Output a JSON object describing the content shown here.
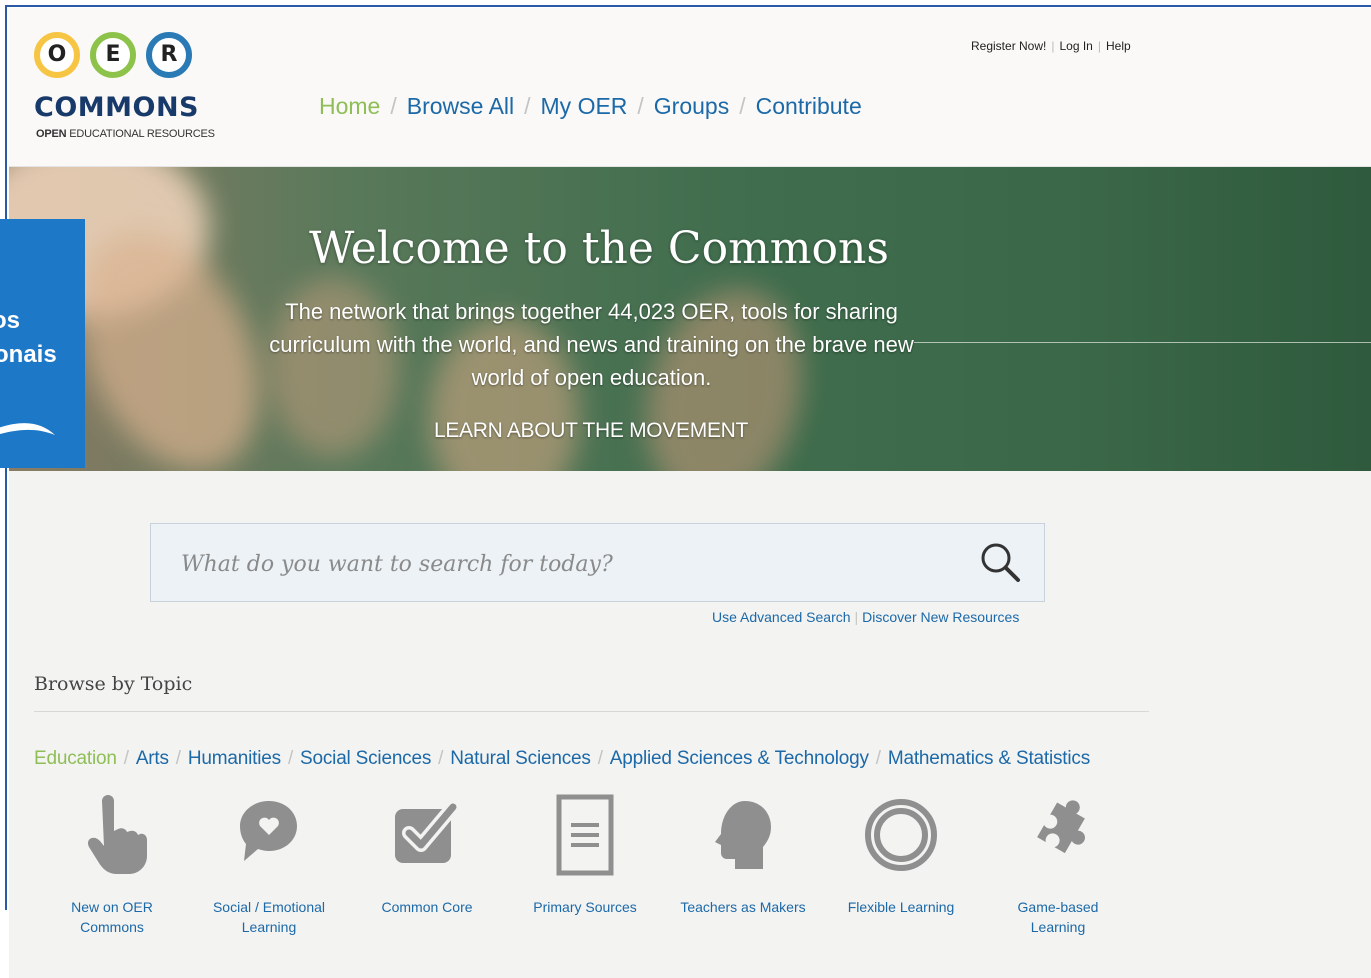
{
  "header": {
    "logo": {
      "letters": [
        "O",
        "E",
        "R"
      ],
      "wordmark": "COMMONS",
      "tagline_bold": "OPEN",
      "tagline_rest": " EDUCATIONAL RESOURCES"
    },
    "util_links": [
      "Register Now!",
      "Log In",
      "Help"
    ],
    "nav": [
      "Home",
      "Browse All",
      "My OER",
      "Groups",
      "Contribute"
    ]
  },
  "hero": {
    "title": "Welcome to the Commons",
    "text": "The network that brings together 44,023 OER, tools for sharing curriculum with the world, and news and training on the brave new world of open education.",
    "link": "LEARN ABOUT THE MOVEMENT"
  },
  "overlay": {
    "line1": "os",
    "line2": "onais"
  },
  "search": {
    "placeholder": "What do you want to search for today?",
    "advanced": "Use Advanced Search",
    "discover": "Discover New Resources"
  },
  "browse": {
    "title": "Browse by Topic",
    "topics": [
      "Education",
      "Arts",
      "Humanities",
      "Social Sciences",
      "Natural Sciences",
      "Applied Sciences & Technology",
      "Mathematics & Statistics"
    ],
    "tiles": [
      {
        "line1": "New on OER",
        "line2": "Commons",
        "icon": "pointing-hand-icon"
      },
      {
        "line1": "Social / Emotional",
        "line2": "Learning",
        "icon": "heart-speech-bubble-icon"
      },
      {
        "line1": "Common Core",
        "line2": "",
        "icon": "checkbox-icon"
      },
      {
        "line1": "Primary Sources",
        "line2": "",
        "icon": "document-icon"
      },
      {
        "line1": "Teachers as Makers",
        "line2": "",
        "icon": "head-profile-icon"
      },
      {
        "line1": "Flexible Learning",
        "line2": "",
        "icon": "ring-icon"
      },
      {
        "line1": "Game-based",
        "line2": "Learning",
        "icon": "puzzle-piece-icon"
      }
    ]
  },
  "colors": {
    "link": "#1c69a8",
    "active": "#8fbe57",
    "icon": "#8f8f8f",
    "overlay": "#1e78c8"
  }
}
